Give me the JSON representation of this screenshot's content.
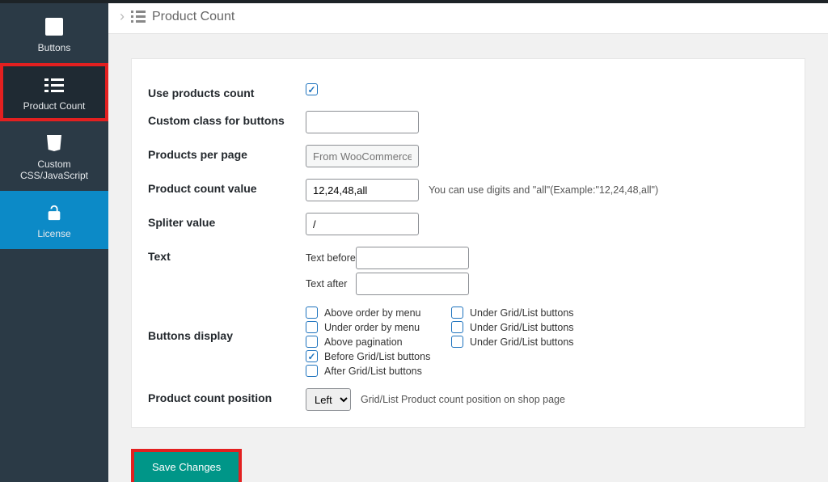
{
  "sidebar": {
    "buttons": "Buttons",
    "product_count": "Product Count",
    "custom_css": "Custom CSS/JavaScript",
    "license": "License"
  },
  "header": {
    "title": "Product Count"
  },
  "form": {
    "use_products_count": {
      "label": "Use products count",
      "checked": true
    },
    "custom_class": {
      "label": "Custom class for buttons",
      "value": ""
    },
    "per_page": {
      "label": "Products per page",
      "placeholder": "From WooCommerce"
    },
    "count_value": {
      "label": "Product count value",
      "value": "12,24,48,all",
      "hint": "You can use digits and \"all\"(Example:\"12,24,48,all\")"
    },
    "splitter": {
      "label": "Spliter value",
      "value": "/"
    },
    "text": {
      "label": "Text",
      "before_label": "Text before",
      "before_value": "",
      "after_label": "Text after",
      "after_value": ""
    },
    "buttons_display": {
      "label": "Buttons display",
      "options": [
        [
          {
            "label": "Above order by menu",
            "checked": false
          },
          {
            "label": "Under Grid/List buttons",
            "checked": false
          }
        ],
        [
          {
            "label": "Under order by menu",
            "checked": false
          },
          {
            "label": "Under Grid/List buttons",
            "checked": false
          }
        ],
        [
          {
            "label": "Above pagination",
            "checked": false
          },
          {
            "label": "Under Grid/List buttons",
            "checked": false
          }
        ],
        [
          {
            "label": "Before Grid/List buttons",
            "checked": true
          }
        ],
        [
          {
            "label": "After Grid/List buttons",
            "checked": false
          }
        ]
      ]
    },
    "position": {
      "label": "Product count position",
      "value": "Left",
      "hint": "Grid/List Product count position on shop page"
    }
  },
  "save": "Save Changes"
}
